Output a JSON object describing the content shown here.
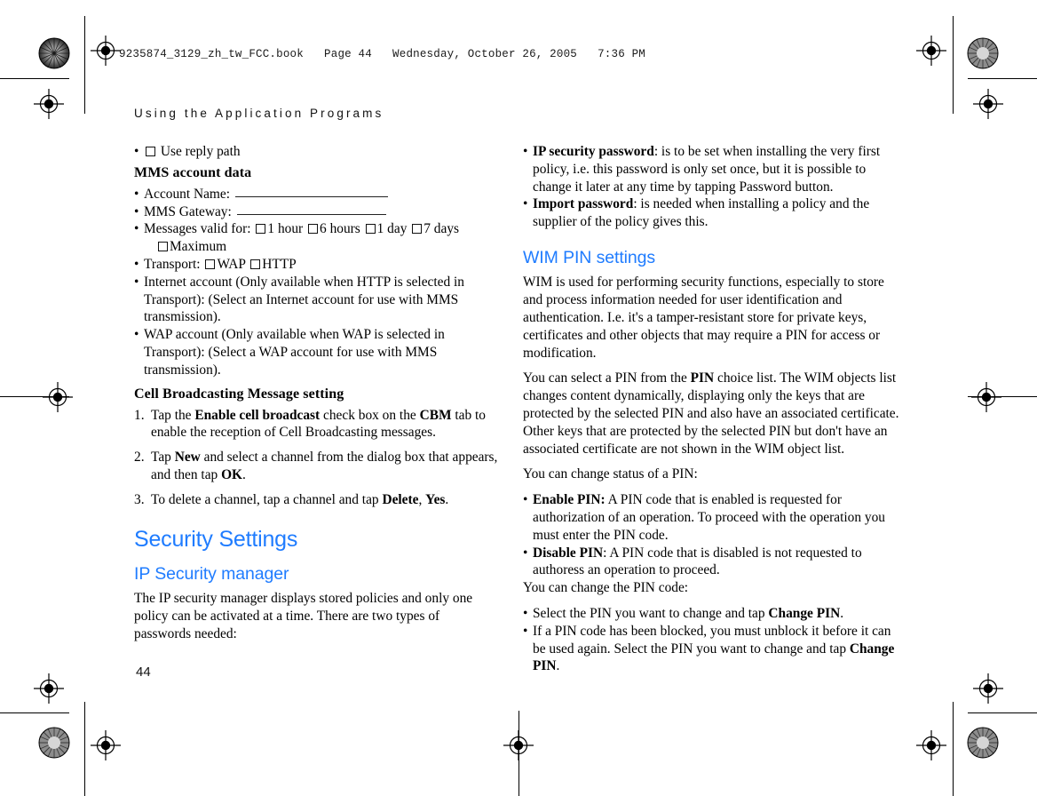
{
  "print_header": {
    "file_line": "9235874_3129_zh_tw_FCC.book   Page 44   Wednesday, October 26, 2005   7:36 PM"
  },
  "running_head": "Using the Application Programs",
  "folio": "44",
  "colors": {
    "heading_blue": "#1f7cff",
    "body_text": "#000000",
    "page_background": "#ffffff"
  },
  "left_column": {
    "use_reply_path": {
      "dot": "•",
      "label": "Use reply path"
    },
    "mms_account_data": {
      "heading": "MMS account data",
      "account_name": {
        "dot": "•",
        "label": "Account Name:"
      },
      "mms_gateway": {
        "dot": "•",
        "label": "MMS Gateway:"
      },
      "messages_valid_for": {
        "dot": "•",
        "label": "Messages valid for:",
        "options": [
          "1 hour",
          "6 hours",
          "1 day",
          "7 days"
        ],
        "extra_option": "Maximum"
      },
      "transport": {
        "dot": "•",
        "label": "Transport:",
        "options": [
          "WAP",
          "HTTP"
        ]
      },
      "internet_account": {
        "dot": "•",
        "text": "Internet account (Only available when HTTP is selected in Transport): (Select an Internet account for use with MMS transmission)."
      },
      "wap_account": {
        "dot": "•",
        "text": "WAP account (Only available when WAP is selected in Transport): (Select a WAP account for use with MMS transmission)."
      }
    },
    "cell_broadcasting": {
      "heading": "Cell Broadcasting Message setting",
      "steps": [
        {
          "num": "1.",
          "pre": "Tap the ",
          "bold1": "Enable cell broadcast",
          "mid": " check box on the ",
          "bold2": "CBM",
          "post": " tab to enable the reception of Cell Broadcasting messages."
        },
        {
          "num": "2.",
          "pre": "Tap ",
          "bold1": "New",
          "mid": " and select a channel from the dialog box that appears, and then tap ",
          "bold2": "OK",
          "post": "."
        },
        {
          "num": "3.",
          "pre": "To delete a channel, tap a channel and tap ",
          "bold1": "Delete",
          "mid": ", ",
          "bold2": "Yes",
          "post": "."
        }
      ]
    },
    "security_settings": {
      "heading": "Security Settings",
      "ip_security_manager": {
        "heading": "IP Security manager",
        "body": "The IP security manager displays stored policies and only one policy can be activated at a time. There are two types of passwords needed:"
      }
    }
  },
  "right_column": {
    "passwords": [
      {
        "dot": "•",
        "term": "IP security password",
        "text": ": is to be set when installing the very first policy, i.e. this password is only set once, but it is possible to change it later at any time by tapping Password button."
      },
      {
        "dot": "•",
        "term": "Import password",
        "text": ": is needed when installing a policy and the supplier of the policy gives this."
      }
    ],
    "wim_pin_settings": {
      "heading": "WIM PIN settings",
      "intro": "WIM is used for performing security functions, especially to store and process information needed for user identification and authentication. I.e. it's a tamper-resistant store for private keys, certificates and other objects that may require a PIN for access or modification.",
      "choice_list": {
        "pre": "You can select a PIN from the ",
        "bold": "PIN",
        "post": " choice list. The WIM objects list changes content dynamically, displaying only the keys that are protected by the selected PIN and also have an associated certificate. Other keys that are protected by the selected PIN but don't have an associated certificate are not shown in the WIM object list."
      },
      "status_lead": "You can change status of a PIN:",
      "status_items": [
        {
          "dot": "•",
          "term": "Enable PIN:",
          "text": " A PIN code that is enabled is requested for authorization of an operation. To proceed with the operation you must enter the PIN code."
        },
        {
          "dot": "•",
          "term": "Disable PIN",
          "text": ": A PIN code that is disabled is not requested to authoress an operation to proceed."
        }
      ],
      "code_lead": "You can change the PIN code:",
      "code_items": [
        {
          "dot": "•",
          "pre": "Select the PIN you want to change and tap ",
          "bold": "Change PIN",
          "post": "."
        },
        {
          "dot": "•",
          "pre": "If a PIN code has been blocked, you must unblock it before it can be used again. Select the PIN you want to change and tap ",
          "bold": "Change PIN",
          "post": "."
        }
      ]
    }
  }
}
